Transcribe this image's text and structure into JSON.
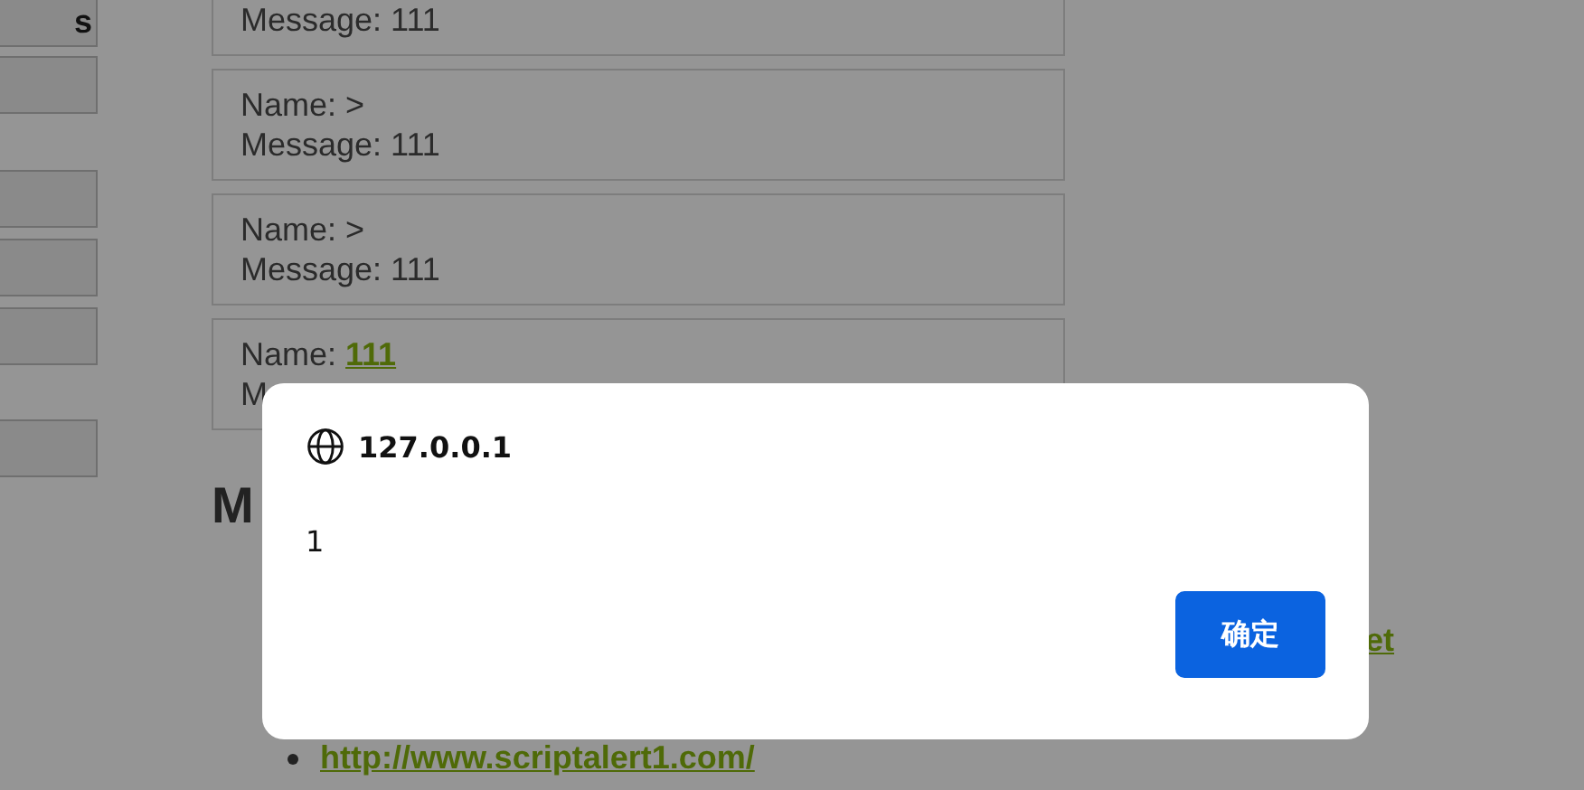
{
  "sidebar": {
    "first_button_label": "s"
  },
  "messages": [
    {
      "lines": [
        {
          "label": "Message:",
          "value": "111"
        }
      ]
    },
    {
      "lines": [
        {
          "label": "Name:",
          "value": ">"
        },
        {
          "label": "Message:",
          "value": "111"
        }
      ]
    },
    {
      "lines": [
        {
          "label": "Name:",
          "value": ">"
        },
        {
          "label": "Message:",
          "value": "111"
        }
      ]
    },
    {
      "lines": [
        {
          "label": "Name:",
          "value": "111",
          "kind": "link"
        },
        {
          "label": "M"
        }
      ]
    }
  ],
  "heading": "M",
  "links": [
    {
      "text": "et",
      "kind": "wrapped"
    },
    {
      "text": "http://www.scriptalert1.com/",
      "kind": "bullet"
    }
  ],
  "dialog": {
    "origin": "127.0.0.1",
    "message": "1",
    "ok_button": "确定"
  }
}
